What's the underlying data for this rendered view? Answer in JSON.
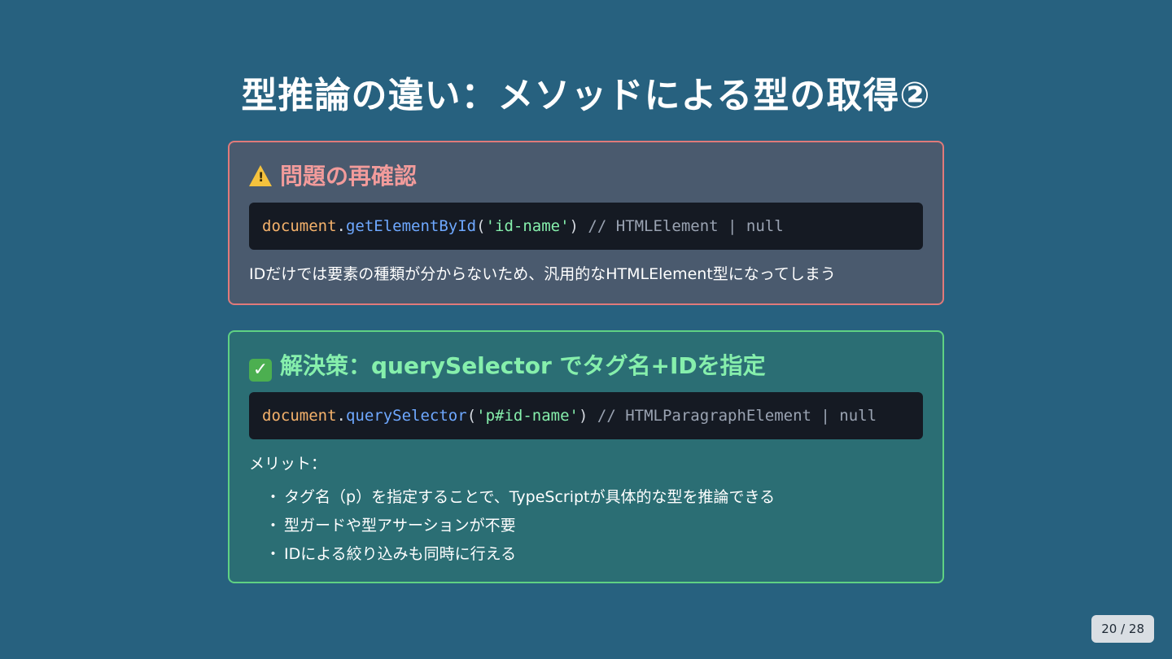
{
  "slide": {
    "title": "型推論の違い：メソッドによる型の取得②",
    "page_current": "20",
    "page_separator": " / ",
    "page_total": "28"
  },
  "problem": {
    "icon": "warning-icon",
    "heading": "問題の再確認",
    "code": {
      "object": "document",
      "dot": ".",
      "method": "getElementById",
      "open_paren": "(",
      "argument": "'id-name'",
      "close_paren": ")",
      "comment": " // HTMLElement | null"
    },
    "description": "IDだけでは要素の種類が分からないため、汎用的なHTMLElement型になってしまう"
  },
  "solution": {
    "icon": "check-mark-icon",
    "heading": "解決策：querySelector でタグ名+IDを指定",
    "code": {
      "object": "document",
      "dot": ".",
      "method": "querySelector",
      "open_paren": "(",
      "argument": "'p#id-name'",
      "close_paren": ")",
      "comment": " // HTMLParagraphElement | null"
    },
    "merit_label": "メリット：",
    "merits": [
      "タグ名（p）を指定することで、TypeScriptが具体的な型を推論できる",
      "型ガードや型アサーションが不要",
      "IDによる絞り込みも同時に行える"
    ],
    "bullet": "・"
  },
  "colors": {
    "background": "#27617f",
    "problem_border": "#e07a7a",
    "solution_border": "#5fd183",
    "code_background": "#151a23"
  }
}
